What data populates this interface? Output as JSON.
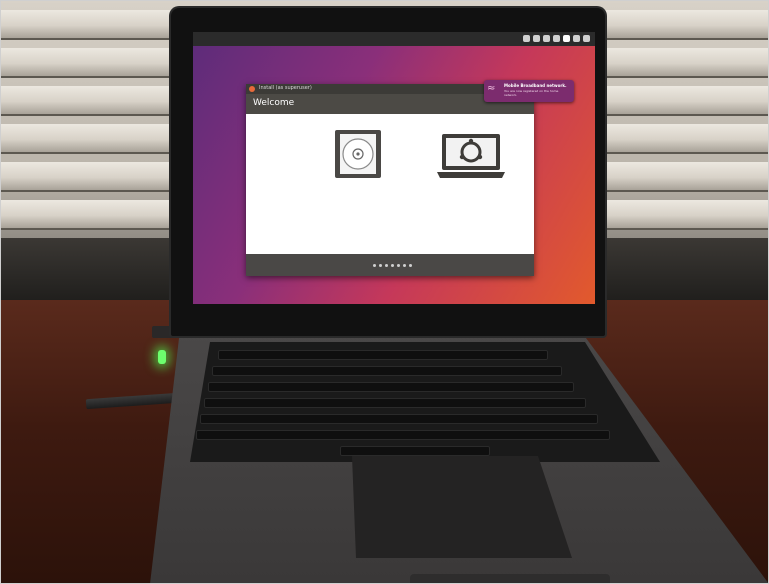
{
  "screen": {
    "installer": {
      "title": "Install (as superuser)",
      "heading": "Welcome",
      "icons": [
        "cd-icon",
        "laptop-icon"
      ],
      "page_dots": 7
    },
    "notification": {
      "title": "Mobile Broadband network.",
      "body": "You are now registered on the home network."
    }
  }
}
